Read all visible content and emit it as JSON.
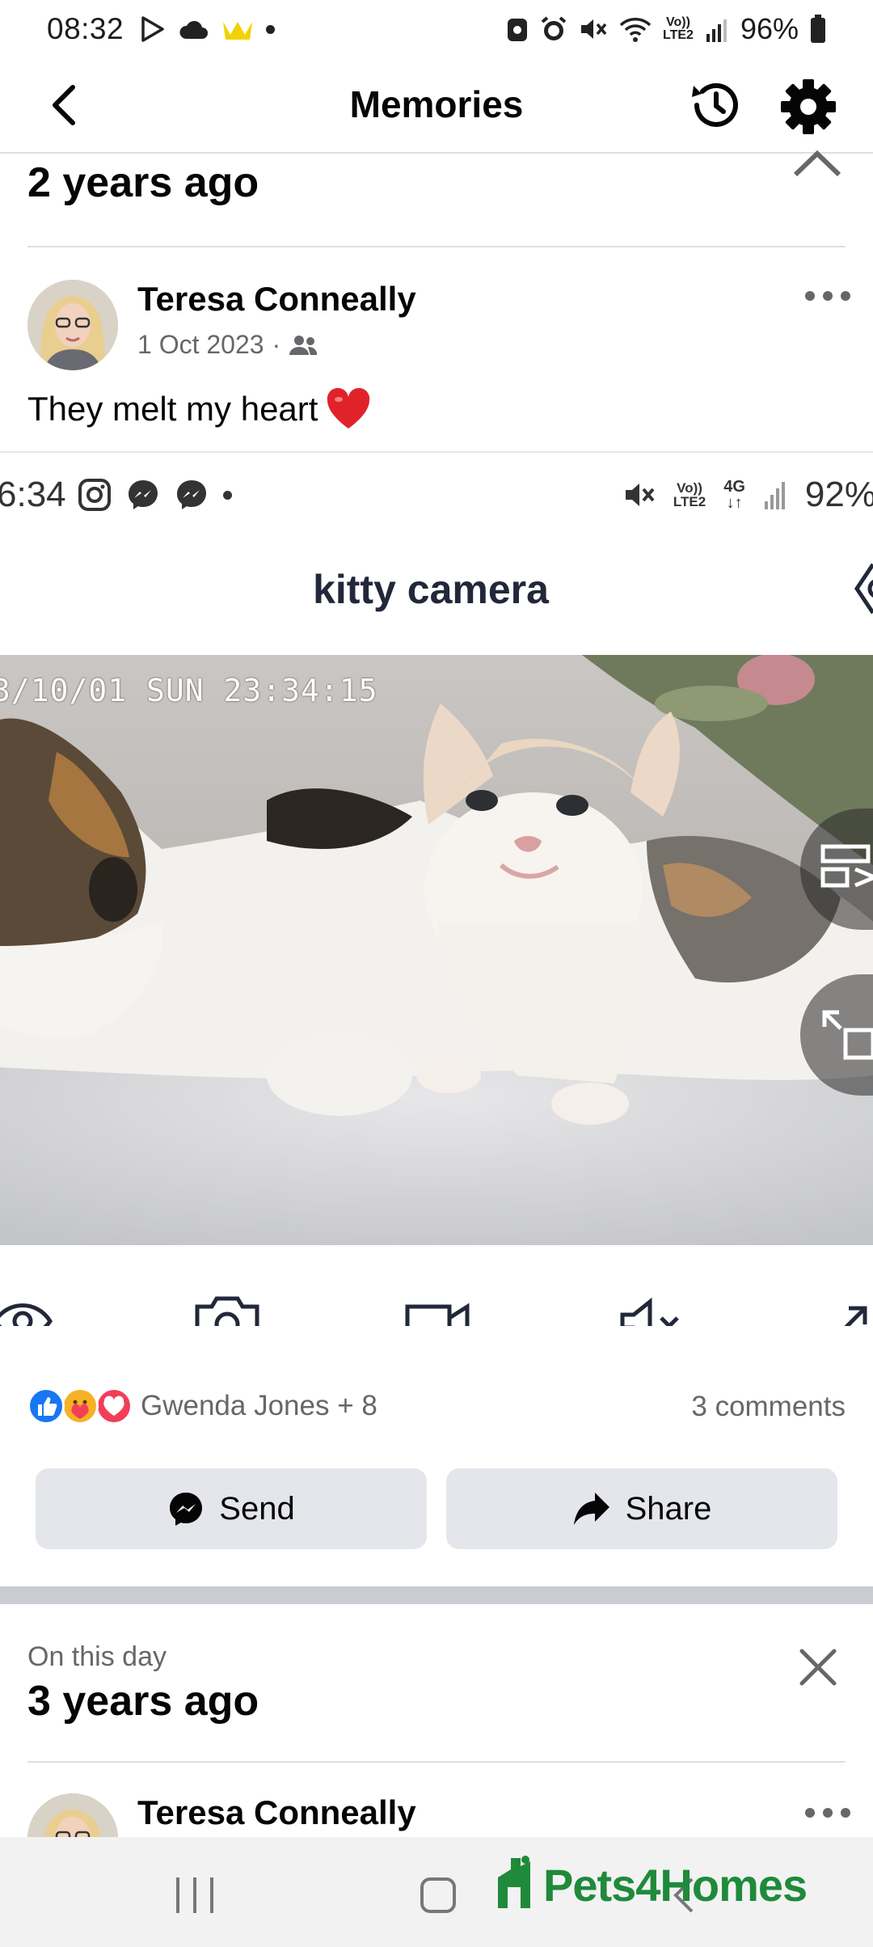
{
  "status_bar": {
    "time": "08:32",
    "battery": "96%",
    "network": "LTE2"
  },
  "header": {
    "title": "Memories",
    "back_icon": "back-arrow-icon",
    "history_icon": "history-icon",
    "settings_icon": "gear-icon"
  },
  "memory1": {
    "ago": "2 years ago",
    "post": {
      "author": "Teresa Conneally",
      "date": "1 Oct 2023",
      "separator": "·",
      "audience_icon": "friends-icon",
      "text": "They melt my heart",
      "emoji": "❤️"
    },
    "embedded": {
      "time": "6:34",
      "battery": "92%",
      "app_title": "kitty camera",
      "timestamp": "3/10/01 SUN 23:34:15"
    },
    "reactions": {
      "names": "Gwenda Jones + 8",
      "comments": "3 comments"
    },
    "actions": {
      "send": "Send",
      "share": "Share"
    }
  },
  "memory2": {
    "label": "On this day",
    "ago": "3 years ago",
    "author": "Teresa Conneally"
  },
  "watermark": "Pets4Homes",
  "colors": {
    "facebook_blue": "#1877F2",
    "button_gray": "#E4E6EB",
    "secondary_text": "#65676B",
    "watermark_green": "#1F8A3A"
  }
}
